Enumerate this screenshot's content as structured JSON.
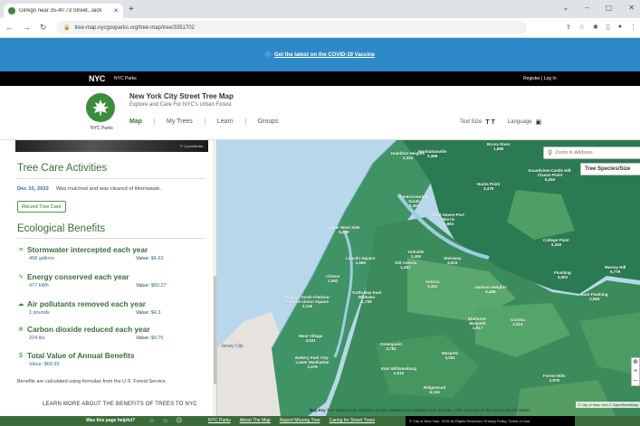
{
  "browser": {
    "tab_title": "Ginkgo near 35-40 73 Street, Jack",
    "new_tab": "+",
    "url": "tree-map.nycgovparks.org/tree-map/tree/3351702",
    "window_controls": [
      "⌄",
      "–",
      "▢",
      "✕"
    ]
  },
  "covid_banner": {
    "link_text": "Get the latest on the COVID-19 Vaccine"
  },
  "nyc_bar": {
    "logo": "NYC",
    "parks": "NYC Parks",
    "register_login": "Register  |  Log In"
  },
  "header": {
    "logo_label": "NYC Parks",
    "title": "New York City Street Tree Map",
    "subtitle": "Explore and Care For NYC's Urban Forest",
    "nav": [
      "Map",
      "My Trees",
      "Learn",
      "Groups"
    ],
    "text_size_label": "Text Size",
    "text_size_glyph": "T T",
    "language_label": "Language"
  },
  "sidebar": {
    "photo_credit": "© CycloMedia",
    "care_heading": "Tree Care Activities",
    "care_date": "Dec 10, 2022",
    "care_text": "Was mulched and was cleared of litter/waste.",
    "record_button": "Record Tree Care",
    "eco_heading": "Ecological Benefits",
    "value_label": "Value:",
    "benefits": [
      {
        "title": "Stormwater intercepted each year",
        "amount": "468",
        "unit": "gallons",
        "value": "$4.63",
        "icon": "water-drop-icon"
      },
      {
        "title": "Energy conserved each year",
        "amount": "477",
        "unit": "kWh",
        "value": "$60.27",
        "icon": "lightning-icon"
      },
      {
        "title": "Air pollutants removed each year",
        "amount": "1",
        "unit": "pounds",
        "value": "$4.3",
        "icon": "cloud-icon"
      },
      {
        "title": "Carbon dioxide reduced each year",
        "amount": "224",
        "unit": "lbs",
        "value": "$0.75",
        "icon": "globe-icon"
      },
      {
        "title": "Total Value of Annual Benefits",
        "amount": "",
        "unit": "",
        "value": "$69.95",
        "icon": "dollar-icon"
      }
    ],
    "note": "Benefits are calculated using formulas from the U.S. Forest Service.",
    "learn_more": "LEARN MORE ABOUT THE BENEFITS OF TREES TO NYC"
  },
  "map": {
    "search_placeholder": "Zoom to Address",
    "species_button": "Tree Species/Size",
    "zoom_buttons": [
      "⊕",
      "+",
      "–"
    ],
    "attribution": "© City of New York © OpenStreetMap",
    "city_label": "Jersey City",
    "key_label": "Map Key",
    "key_text": "Tree marker color indicates species. Marker size indicates trunk diameter. Click on a tree on the map to see full details.",
    "labels": [
      {
        "name": "Hamilton Heights",
        "count": "2,334"
      },
      {
        "name": "Manhattanville",
        "count": "2,368"
      },
      {
        "name": "Bronx River",
        "count": "1,680"
      },
      {
        "name": "Soundview-Castle Hill-Clason Point",
        "count": "5,260"
      },
      {
        "name": "Central Harlem South",
        "count": "2,491"
      },
      {
        "name": "Mott Haven-Port Morris",
        "count": "2,883"
      },
      {
        "name": "Hunts Point",
        "count": "3,470"
      },
      {
        "name": "Upper West Side",
        "count": "5,388"
      },
      {
        "name": "Yorkville",
        "count": "2,408"
      },
      {
        "name": "Steinway",
        "count": "4,915"
      },
      {
        "name": "College Point",
        "count": "3,449"
      },
      {
        "name": "Lincoln Square",
        "count": "1,656"
      },
      {
        "name": "Old Astoria",
        "count": "1,403"
      },
      {
        "name": "Astoria",
        "count": "4,451"
      },
      {
        "name": "Jackson Heights",
        "count": "6,486"
      },
      {
        "name": "Flushing",
        "count": "3,003"
      },
      {
        "name": "Murray Hill",
        "count": "6,779"
      },
      {
        "name": "East Flushing",
        "count": "3,583"
      },
      {
        "name": "Clinton",
        "count": "2,082"
      },
      {
        "name": "Turtle Bay-East Midtown",
        "count": "1,708"
      },
      {
        "name": "Hudson Yards-Chelsea-Flatiron-Union Square",
        "count": "3,135"
      },
      {
        "name": "Elmhurst-Maspeth",
        "count": "1,917"
      },
      {
        "name": "Corona",
        "count": "2,313"
      },
      {
        "name": "West Village",
        "count": "3,931"
      },
      {
        "name": "Greenpoint",
        "count": "3,782"
      },
      {
        "name": "Maspeth",
        "count": "3,001"
      },
      {
        "name": "Battery Park City-Lower Manhattan",
        "count": "2,378"
      },
      {
        "name": "East Williamsburg",
        "count": "2,516"
      },
      {
        "name": "Ridgewood",
        "count": "6,134"
      },
      {
        "name": "Forest Hills",
        "count": "2,978"
      }
    ]
  },
  "footer": {
    "help": "Was this page helpful?",
    "smileys": "☺ ☺ ☹",
    "links": [
      "NYC Parks",
      "About The Map",
      "Report Missing Tree",
      "Caring for Street Trees"
    ],
    "copyright": "© City of New York. 2016 All Rights Reserved. Privacy Policy. Terms of Use."
  }
}
